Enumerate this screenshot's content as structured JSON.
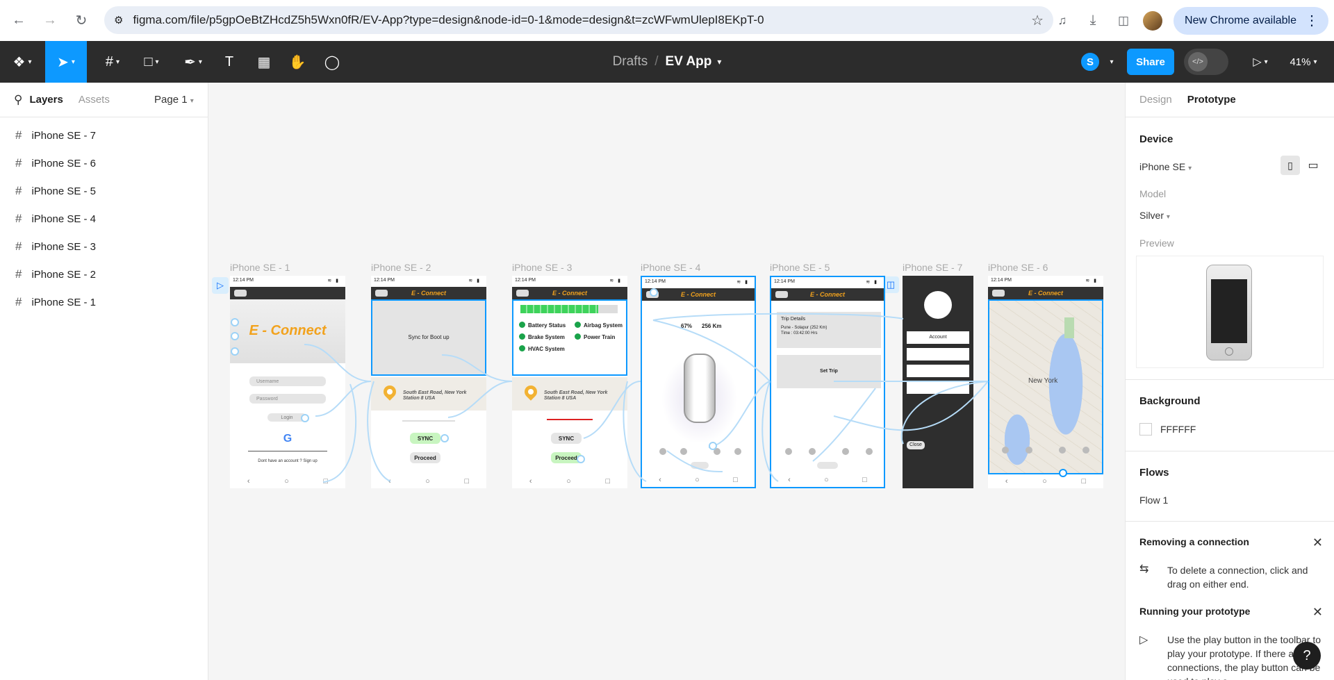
{
  "browser": {
    "url": "figma.com/file/p5gpOeBtZHcdZ5h5Wxn0fR/EV-App?type=design&node-id=0-1&mode=design&t=zcWFwmUlepI8EKpT-0",
    "new_chrome": "New Chrome available"
  },
  "toolbar": {
    "drafts": "Drafts",
    "separator": "/",
    "file_name": "EV App",
    "share_label": "Share",
    "user_initial": "S",
    "zoom": "41%"
  },
  "left_panel": {
    "tab_layers": "Layers",
    "tab_assets": "Assets",
    "page": "Page 1",
    "layers": [
      "iPhone SE - 7",
      "iPhone SE - 6",
      "iPhone SE - 5",
      "iPhone SE - 4",
      "iPhone SE - 3",
      "iPhone SE - 2",
      "iPhone SE - 1"
    ]
  },
  "canvas": {
    "frame_labels": [
      "iPhone SE - 1",
      "iPhone SE - 2",
      "iPhone SE - 3",
      "iPhone SE - 4",
      "iPhone SE - 5",
      "iPhone SE - 7",
      "iPhone SE - 6"
    ],
    "status_time": "12:14 PM",
    "brand": "E - Connect",
    "f1": {
      "logo": "E - Connect",
      "username": "Username",
      "password": "Password",
      "login": "Login",
      "google": "G",
      "signup": "Dont have an account ? Sign up"
    },
    "f2": {
      "sync_text": "Sync for Boot up",
      "address": "South East Road, New York Station 8  USA",
      "sync_btn": "SYNC",
      "proceed_btn": "Proceed"
    },
    "f3": {
      "checks": [
        "Battery Status",
        "Airbag System",
        "Brake System",
        "Power Train",
        "HVAC System"
      ],
      "address": "South East Road, New York Station 8  USA",
      "sync_btn": "SYNC",
      "proceed_btn": "Proceed"
    },
    "f4": {
      "battery": "67%",
      "range": "256 Km"
    },
    "f5": {
      "trip_title": "Trip Details",
      "route": "Pune - Solapur   (252 Km)",
      "time": "Time : 03:42:00 Hrs",
      "set_trip": "Set Trip"
    },
    "f7": {
      "account": "Account",
      "close": "Close"
    },
    "f6": {
      "map_label": "New York"
    }
  },
  "right_panel": {
    "tab_design": "Design",
    "tab_prototype": "Prototype",
    "device_title": "Device",
    "device_value": "iPhone SE",
    "model_label": "Model",
    "model_value": "Silver",
    "preview_label": "Preview",
    "background_title": "Background",
    "background_hex": "FFFFFF",
    "flows_title": "Flows",
    "flow_name": "Flow 1",
    "hint1_title": "Removing a connection",
    "hint1_text": "To delete a connection, click and drag on either end.",
    "hint2_title": "Running your prototype",
    "hint2_text": "Use the play button in the toolbar to play your prototype. If there are no connections, the play button can be used to play a",
    "help": "?"
  },
  "colors": {
    "accent": "#0d99ff",
    "toolbar_bg": "#2c2c2c",
    "brand_orange": "#f2a21d"
  }
}
